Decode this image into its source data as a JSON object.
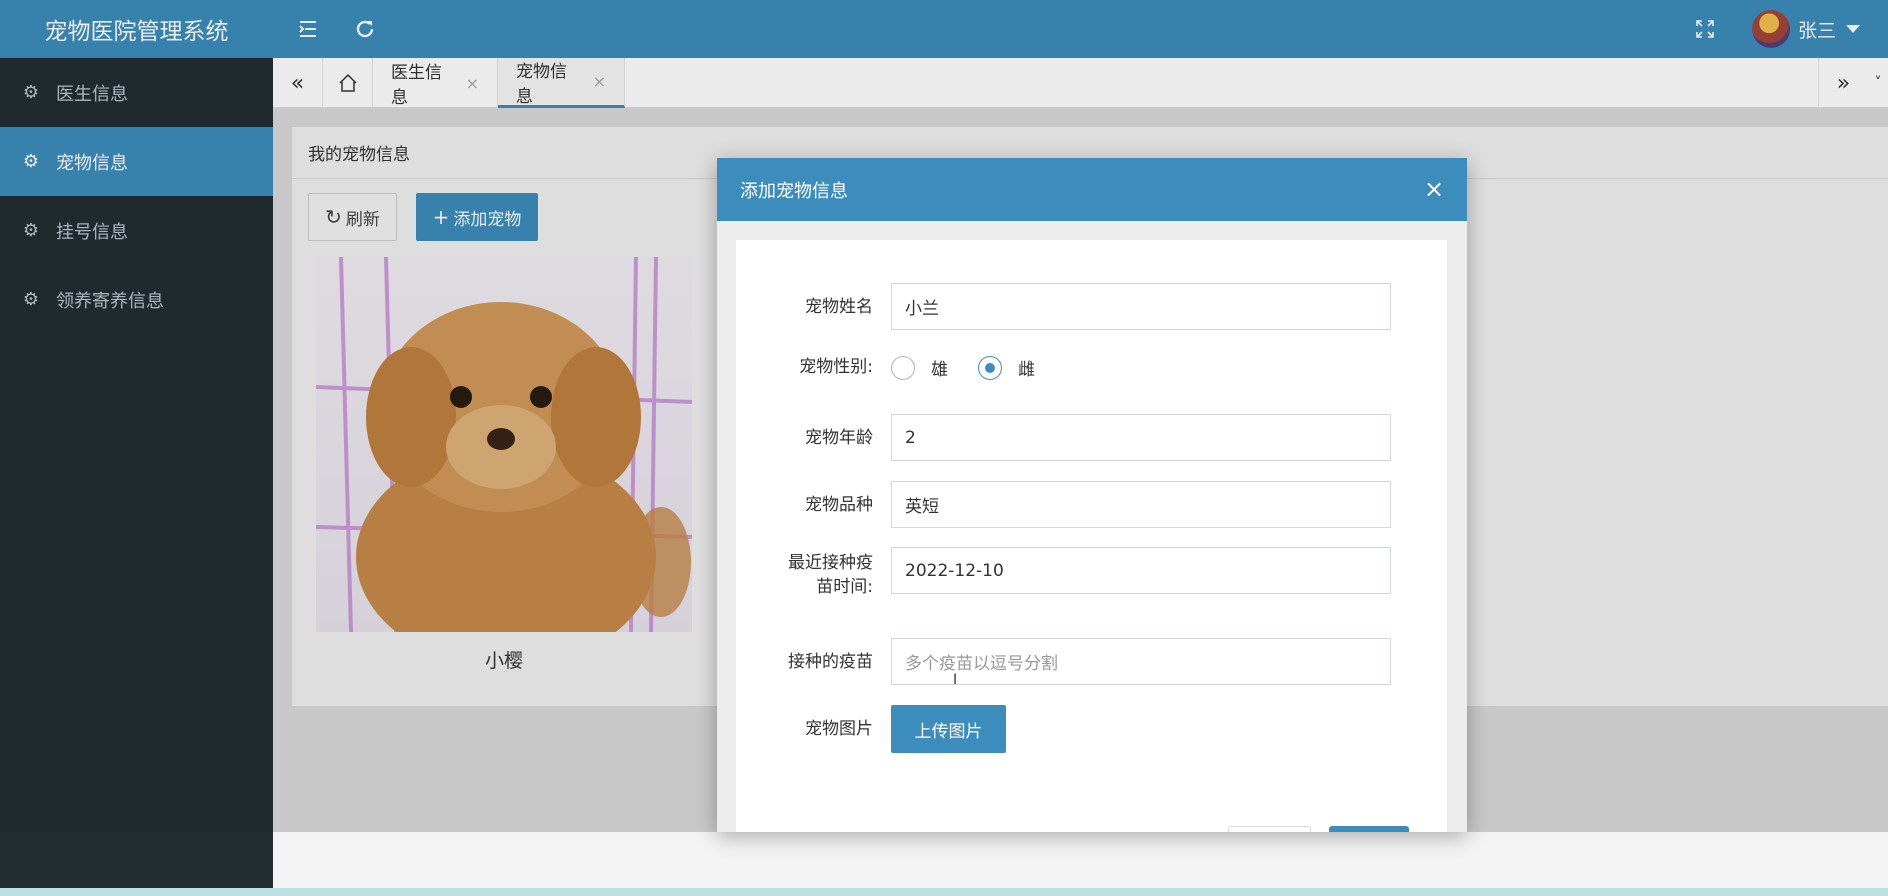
{
  "app": {
    "title": "宠物医院管理系统"
  },
  "user": {
    "name": "张三"
  },
  "sidebar": {
    "items": [
      {
        "label": "医生信息",
        "active": false
      },
      {
        "label": "宠物信息",
        "active": true
      },
      {
        "label": "挂号信息",
        "active": false
      },
      {
        "label": "领养寄养信息",
        "active": false
      }
    ]
  },
  "tabs": {
    "items": [
      {
        "label": "医生信息",
        "close": "×"
      },
      {
        "label": "宠物信息",
        "close": "×",
        "active": true
      }
    ]
  },
  "panel": {
    "title": "我的宠物信息",
    "refresh_label": "刷新",
    "add_label": "添加宠物"
  },
  "pets": [
    {
      "name": "小樱"
    }
  ],
  "modal": {
    "title": "添加宠物信息",
    "fields": {
      "name": {
        "label": "宠物姓名",
        "value": "小兰"
      },
      "gender": {
        "label": "宠物性别:",
        "options": [
          "雄",
          "雌"
        ],
        "selected": "雌"
      },
      "age": {
        "label": "宠物年龄",
        "value": "2"
      },
      "breed": {
        "label": "宠物品种",
        "value": "英短"
      },
      "vaccine_date": {
        "label": "最近接种疫苗时间:",
        "value": "2022-12-10"
      },
      "vaccines": {
        "label": "接种的疫苗",
        "placeholder": "多个疫苗以逗号分割",
        "value": ""
      },
      "photo": {
        "label": "宠物图片",
        "button": "上传图片"
      }
    }
  },
  "icons": {
    "menu": "menu-icon",
    "refresh": "refresh-icon",
    "fullscreen": "fullscreen-icon",
    "gear": "gear-icon",
    "home": "home-icon",
    "close": "close-icon"
  },
  "colors": {
    "primary": "#3c8dbc",
    "sidebar_bg": "#222d32",
    "sidebar_text": "#b8c7ce"
  }
}
